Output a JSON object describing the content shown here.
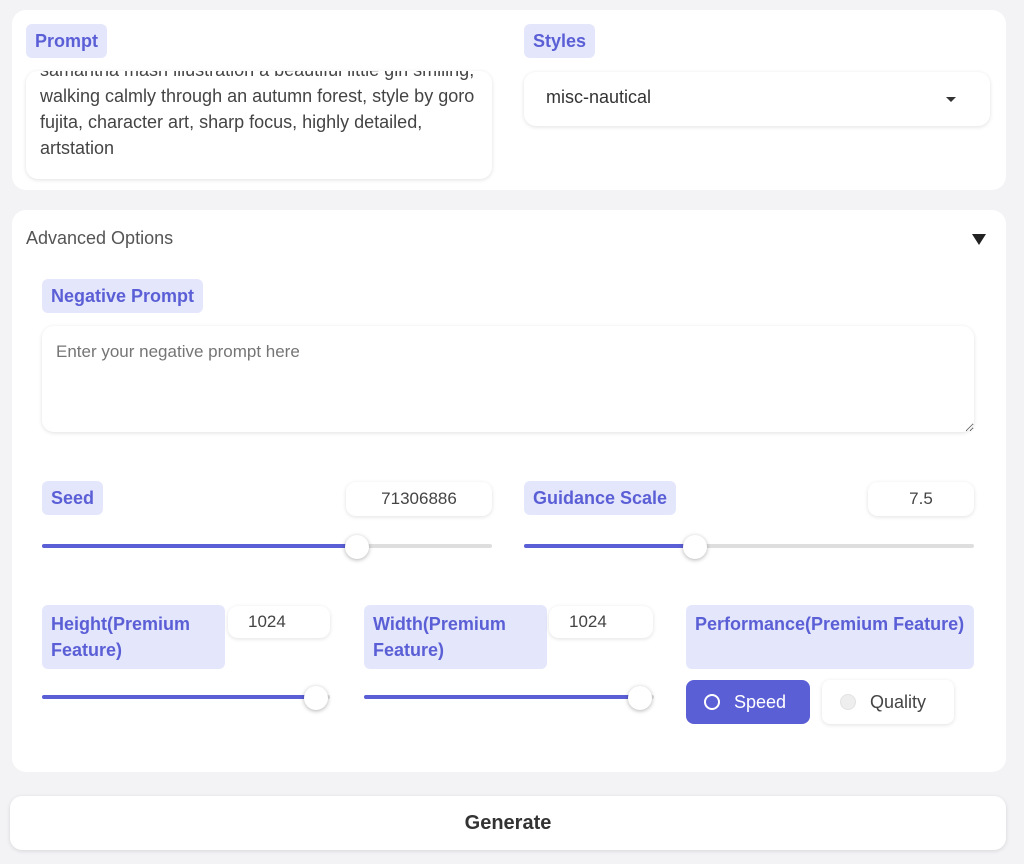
{
  "prompt": {
    "label": "Prompt",
    "value": "samantha mash illustration a beautiful little girl smiling, walking calmly through an autumn forest, style by goro fujita, character art, sharp focus, highly detailed, artstation"
  },
  "styles": {
    "label": "Styles",
    "selected": "misc-nautical"
  },
  "advanced": {
    "title": "Advanced Options",
    "negative_prompt": {
      "label": "Negative Prompt",
      "placeholder": "Enter your negative prompt here"
    },
    "seed": {
      "label": "Seed",
      "value": "71306886",
      "fraction": 0.7
    },
    "guidance_scale": {
      "label": "Guidance Scale",
      "value": "7.5",
      "fraction": 0.38
    },
    "height": {
      "label": "Height(Premium Feature)",
      "value": "1024",
      "fraction": 0.95
    },
    "width": {
      "label": "Width(Premium Feature)",
      "value": "1024",
      "fraction": 0.95
    },
    "performance": {
      "label": "Performance(Premium Feature)",
      "options": [
        "Speed",
        "Quality"
      ],
      "selected": "Speed"
    }
  },
  "generate_label": "Generate",
  "colors": {
    "accent": "#5b5fd6",
    "chip_bg": "#e4e6fb"
  }
}
